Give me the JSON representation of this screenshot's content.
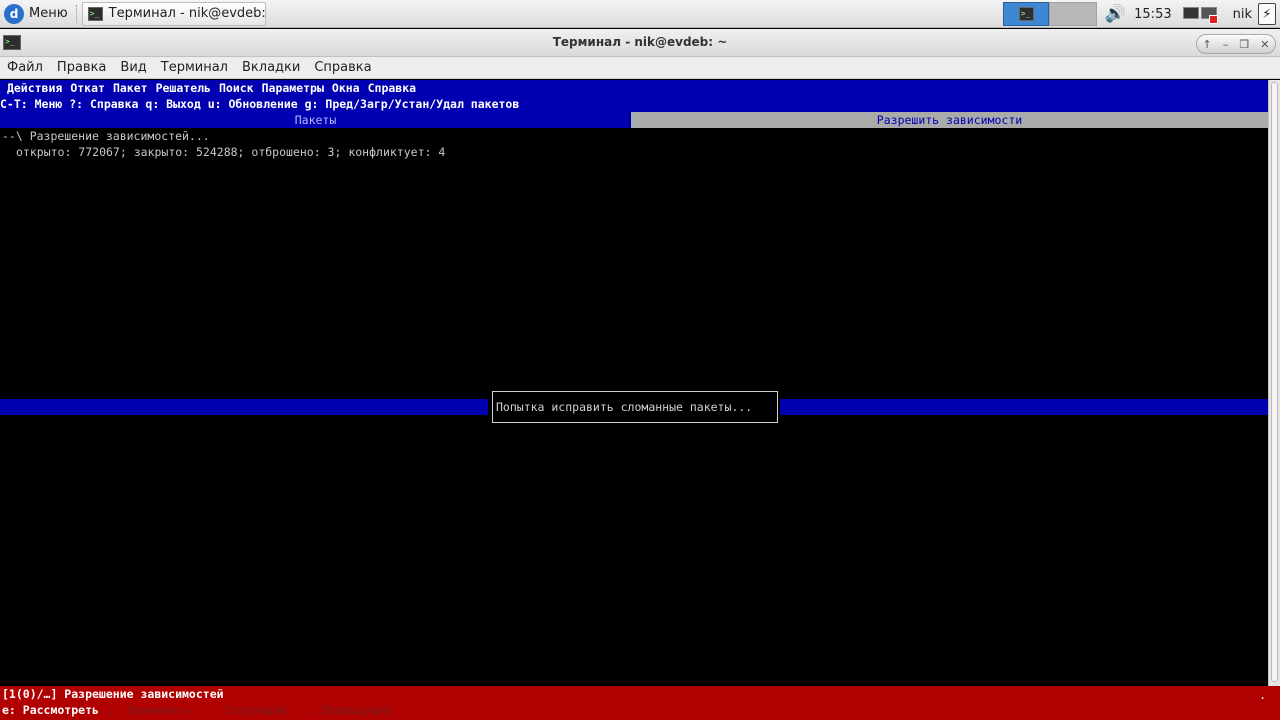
{
  "taskbar": {
    "menu_label": "Меню",
    "task_label": "Терминал - nik@evdeb:...",
    "clock": "15:53",
    "user": "nik"
  },
  "window": {
    "title": "Терминал - nik@evdeb: ~",
    "controls": [
      "↑",
      "–",
      "❐",
      "✕"
    ]
  },
  "menubar": [
    "Файл",
    "Правка",
    "Вид",
    "Терминал",
    "Вкладки",
    "Справка"
  ],
  "aptitude": {
    "menu": [
      "Действия",
      "Откат",
      "Пакет",
      "Решатель",
      "Поиск",
      "Параметры",
      "Окна",
      "Справка"
    ],
    "help_line": "C-T: Меню ?: Справка q: Выход u: Обновление g: Пред/Загр/Устан/Удал пакетов",
    "tab_packages": "Пакеты",
    "tab_resolve": "Разрешить зависимости",
    "line1": "--\\ Разрешение зависимостей...",
    "line2": "открыто: 772067; закрыто: 524288; отброшено: 3; конфликтует: 4",
    "dialog": "Попытка исправить сломанные пакеты...",
    "status1": "[1(0)/…] Разрешение зависимостей",
    "status_key": "e: Рассмотреть",
    "status_dim": ",: Применить  .: Следующий  ,: Предыдущий",
    "status_dot": "."
  },
  "colors": {
    "aptitude_blue": "#0000b0",
    "status_red": "#b00000",
    "tab_inactive": "#aaaaaa"
  }
}
